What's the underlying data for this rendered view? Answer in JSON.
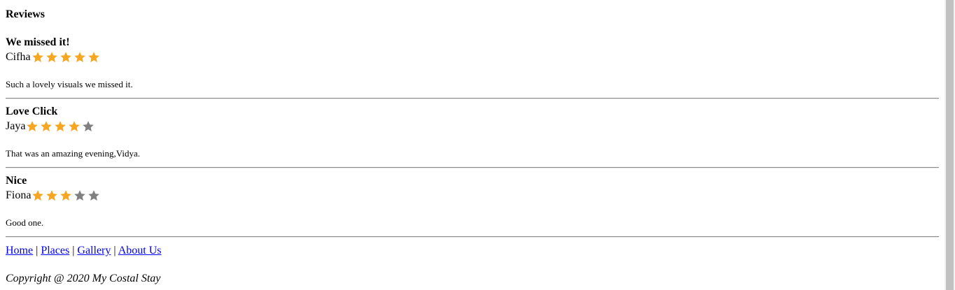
{
  "page": {
    "heading": "Reviews"
  },
  "colors": {
    "star_filled": "#f5a623",
    "star_empty": "#808080",
    "link": "#0000ee"
  },
  "reviews": [
    {
      "title": "We missed it!",
      "author": "Cifha",
      "rating": 5,
      "max_rating": 5,
      "text": "Such a lovely visuals we missed it."
    },
    {
      "title": "Love Click",
      "author": "Jaya",
      "rating": 4,
      "max_rating": 5,
      "text": "That was an amazing evening,Vidya."
    },
    {
      "title": "Nice",
      "author": "Fiona",
      "rating": 3,
      "max_rating": 5,
      "text": "Good one."
    }
  ],
  "footer": {
    "nav": [
      {
        "label": "Home"
      },
      {
        "label": "Places"
      },
      {
        "label": "Gallery"
      },
      {
        "label": "About Us"
      }
    ],
    "separator": "|",
    "copyright": "Copyright @ 2020 My Costal Stay"
  }
}
